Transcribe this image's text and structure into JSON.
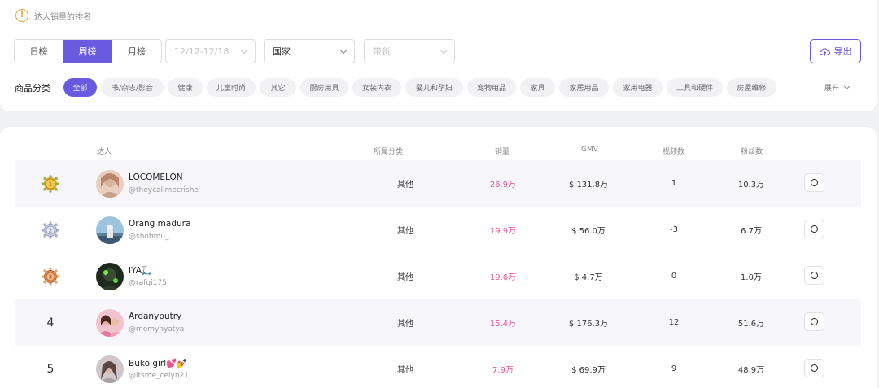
{
  "hint": {
    "icon": "info-icon",
    "text": "达人销量的排名"
  },
  "period_tabs": [
    {
      "label": "日榜",
      "active": false
    },
    {
      "label": "周榜",
      "active": true
    },
    {
      "label": "月榜",
      "active": false
    }
  ],
  "filters": {
    "date_range": "12/12-12/18",
    "country": "国家",
    "sell_goods": "带货"
  },
  "export_label": "导出",
  "category": {
    "label": "商品分类",
    "chips": [
      "全部",
      "书/杂志/影音",
      "健康",
      "儿童时尚",
      "其它",
      "厨房用具",
      "女装内衣",
      "婴儿和孕妇",
      "宠物用品",
      "家具",
      "家居用品",
      "家用电器",
      "工具和硬件",
      "房屋维修"
    ],
    "active_index": 0,
    "expand_label": "展开"
  },
  "table": {
    "columns": {
      "influencer": "达人",
      "category": "所属分类",
      "sales": "销量",
      "gmv": "GMV",
      "videos": "视频数",
      "fans": "粉丝数"
    },
    "rows": [
      {
        "rank": "1",
        "medal": "gold",
        "name": "LOCOMELON",
        "handle": "@theycallmecrishe",
        "category": "其他",
        "sales": "26.9万",
        "gmv": "$ 131.8万",
        "videos": "1",
        "fans": "10.3万"
      },
      {
        "rank": "2",
        "medal": "silver",
        "name": "Orang madura",
        "handle": "@shofimu_",
        "category": "其他",
        "sales": "19.9万",
        "gmv": "$ 56.0万",
        "videos": "-3",
        "fans": "6.7万"
      },
      {
        "rank": "3",
        "medal": "bronze",
        "name": "IYA🛴",
        "handle": "@rafqi175",
        "category": "其他",
        "sales": "19.6万",
        "gmv": "$ 4.7万",
        "videos": "0",
        "fans": "1.0万"
      },
      {
        "rank": "4",
        "medal": "",
        "name": "Ardanyputry",
        "handle": "@momynyatya",
        "category": "其他",
        "sales": "15.4万",
        "gmv": "$ 176.3万",
        "videos": "12",
        "fans": "51.6万"
      },
      {
        "rank": "5",
        "medal": "",
        "name": "Buko girl💕💅",
        "handle": "@itsme_celyn21",
        "category": "其他",
        "sales": "7.9万",
        "gmv": "$ 69.9万",
        "videos": "9",
        "fans": "48.9万"
      }
    ]
  },
  "colors": {
    "accent": "#6a5ae0",
    "sales_text": "#e4569a",
    "warning": "#f0a23a",
    "gold_medal": "#d9a62a",
    "silver_medal": "#8e9bb5",
    "bronze_medal": "#e08a4e"
  }
}
